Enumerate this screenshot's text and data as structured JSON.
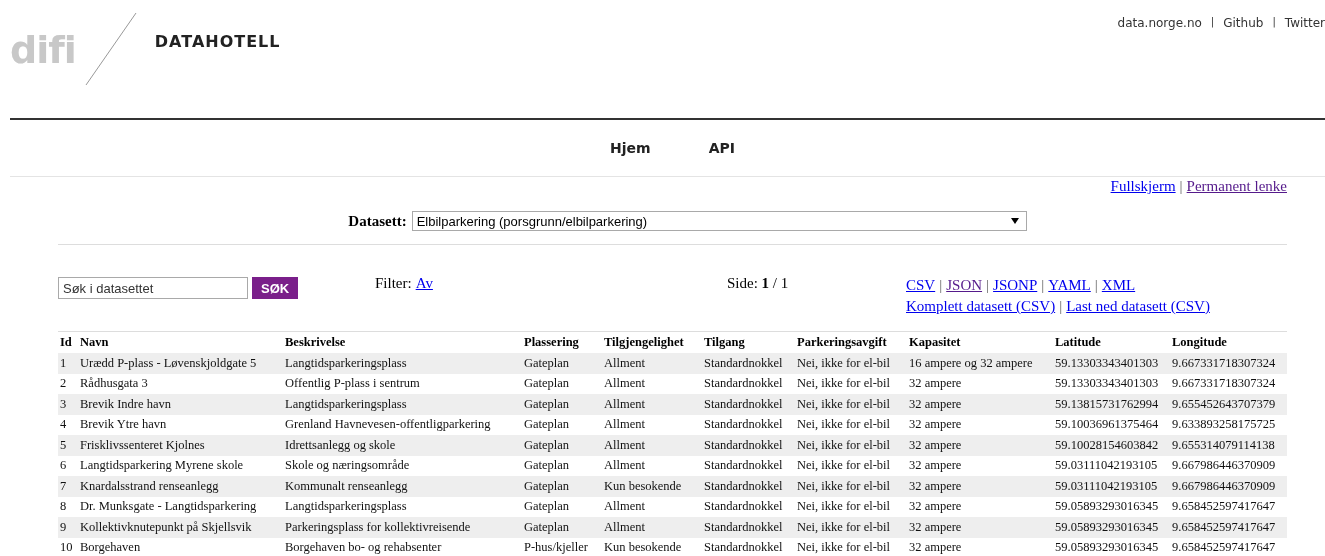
{
  "header": {
    "logo": "difi",
    "title": "DATAHOTELL",
    "separator": "|",
    "links": [
      {
        "label": "data.norge.no"
      },
      {
        "label": "Github"
      },
      {
        "label": "Twitter"
      }
    ]
  },
  "nav": [
    {
      "label": "Hjem"
    },
    {
      "label": "API"
    }
  ],
  "page_links": {
    "separator": "|",
    "items": [
      {
        "label": "Fullskjerm",
        "visited": false
      },
      {
        "label": "Permanent lenke",
        "visited": true
      }
    ]
  },
  "dataset": {
    "label": "Datasett:",
    "value": "Elbilparkering (porsgrunn/elbilparkering)"
  },
  "search": {
    "placeholder": "Søk i datasettet",
    "button": "SØK"
  },
  "filter": {
    "label": "Filter:",
    "link": "Av"
  },
  "paging": {
    "text": "Side: **1** / 1"
  },
  "formats": {
    "separator": "|",
    "items": [
      {
        "label": "CSV",
        "visited": false
      },
      {
        "label": "JSON",
        "visited": true
      },
      {
        "label": "JSONP",
        "visited": false
      },
      {
        "label": "YAML",
        "visited": false
      },
      {
        "label": "XML",
        "visited": false
      }
    ]
  },
  "downloads": {
    "separator": "|",
    "items": [
      {
        "label": "Komplett datasett (CSV)",
        "visited": false
      },
      {
        "label": "Last ned datasett (CSV)",
        "visited": false
      }
    ]
  },
  "table": {
    "columns": [
      "Id",
      "Navn",
      "Beskrivelse",
      "Plassering",
      "Tilgjengelighet",
      "Tilgang",
      "Parkeringsavgift",
      "Kapasitet",
      "Latitude",
      "Longitude"
    ],
    "rows": [
      [
        "1",
        "Urædd P-plass - Løvenskjoldgate 5",
        "Langtidsparkeringsplass",
        "Gateplan",
        "Allment",
        "Standardnokkel",
        "Nei, ikke for el-bil",
        "16 ampere og 32 ampere",
        "59.13303343401303",
        "9.667331718307324"
      ],
      [
        "2",
        "Rådhusgata 3",
        "Offentlig P-plass i sentrum",
        "Gateplan",
        "Allment",
        "Standardnokkel",
        "Nei, ikke for el-bil",
        "32 ampere",
        "59.13303343401303",
        "9.667331718307324"
      ],
      [
        "3",
        "Brevik Indre havn",
        "Langtidsparkeringsplass",
        "Gateplan",
        "Allment",
        "Standardnokkel",
        "Nei, ikke for el-bil",
        "32 ampere",
        "59.13815731762994",
        "9.655452643707379"
      ],
      [
        "4",
        "Brevik Ytre havn",
        "Grenland Havnevesen-offentligparkering",
        "Gateplan",
        "Allment",
        "Standardnokkel",
        "Nei, ikke for el-bil",
        "32 ampere",
        "59.10036961375464",
        "9.633893258175725"
      ],
      [
        "5",
        "Frisklivssenteret Kjolnes",
        "Idrettsanlegg og skole",
        "Gateplan",
        "Allment",
        "Standardnokkel",
        "Nei, ikke for el-bil",
        "32 ampere",
        "59.10028154603842",
        "9.655314079114138"
      ],
      [
        "6",
        "Langtidsparkering Myrene skole",
        "Skole og næringsområde",
        "Gateplan",
        "Allment",
        "Standardnokkel",
        "Nei, ikke for el-bil",
        "32 ampere",
        "59.03111042193105",
        "9.667986446370909"
      ],
      [
        "7",
        "Knardalsstrand renseanlegg",
        "Kommunalt renseanlegg",
        "Gateplan",
        "Kun besokende",
        "Standardnokkel",
        "Nei, ikke for el-bil",
        "32 ampere",
        "59.03111042193105",
        "9.667986446370909"
      ],
      [
        "8",
        "Dr. Munksgate - Langtidsparkering",
        "Langtidsparkeringsplass",
        "Gateplan",
        "Allment",
        "Standardnokkel",
        "Nei, ikke for el-bil",
        "32 ampere",
        "59.05893293016345",
        "9.658452597417647"
      ],
      [
        "9",
        "Kollektivknutepunkt på Skjellsvik",
        "Parkeringsplass for kollektivreisende",
        "Gateplan",
        "Allment",
        "Standardnokkel",
        "Nei, ikke for el-bil",
        "32 ampere",
        "59.05893293016345",
        "9.658452597417647"
      ],
      [
        "10",
        "Borgehaven",
        "Borgehaven bo- og rehabsenter",
        "P-hus/kjeller",
        "Kun besokende",
        "Standardnokkel",
        "Nei, ikke for el-bil",
        "32 ampere",
        "59.05893293016345",
        "9.658452597417647"
      ]
    ]
  }
}
